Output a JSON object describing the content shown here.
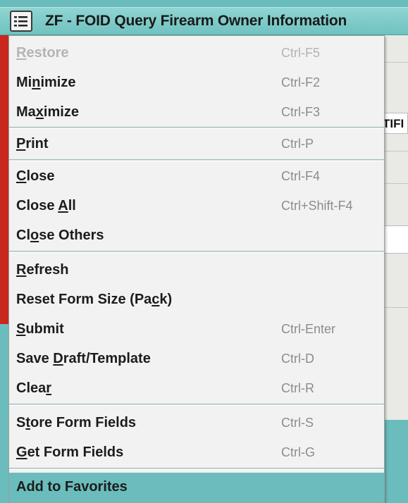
{
  "window": {
    "title": "ZF - FOID Query Firearm Owner Information"
  },
  "background": {
    "field_text": "TIFI"
  },
  "menu": {
    "items": [
      {
        "label_pre": "",
        "mnemonic": "R",
        "label_post": "estore",
        "shortcut": "Ctrl-F5",
        "enabled": false
      },
      {
        "label_pre": "Mi",
        "mnemonic": "n",
        "label_post": "imize",
        "shortcut": "Ctrl-F2",
        "enabled": true
      },
      {
        "label_pre": "Ma",
        "mnemonic": "x",
        "label_post": "imize",
        "shortcut": "Ctrl-F3",
        "enabled": true
      },
      {
        "label_pre": "",
        "mnemonic": "P",
        "label_post": "rint",
        "shortcut": "Ctrl-P",
        "enabled": true
      },
      {
        "label_pre": "",
        "mnemonic": "C",
        "label_post": "lose",
        "shortcut": "Ctrl-F4",
        "enabled": true
      },
      {
        "label_pre": "Close ",
        "mnemonic": "A",
        "label_post": "ll",
        "shortcut": "Ctrl+Shift-F4",
        "enabled": true
      },
      {
        "label_pre": "Cl",
        "mnemonic": "o",
        "label_post": "se Others",
        "shortcut": "",
        "enabled": true
      },
      {
        "label_pre": "",
        "mnemonic": "R",
        "label_post": "efresh",
        "shortcut": "",
        "enabled": true
      },
      {
        "label_pre": "Reset Form Size (Pa",
        "mnemonic": "c",
        "label_post": "k)",
        "shortcut": "",
        "enabled": true
      },
      {
        "label_pre": "",
        "mnemonic": "S",
        "label_post": "ubmit",
        "shortcut": "Ctrl-Enter",
        "enabled": true
      },
      {
        "label_pre": "Save ",
        "mnemonic": "D",
        "label_post": "raft/Template",
        "shortcut": "Ctrl-D",
        "enabled": true
      },
      {
        "label_pre": "Clea",
        "mnemonic": "r",
        "label_post": "",
        "shortcut": "Ctrl-R",
        "enabled": true
      },
      {
        "label_pre": "S",
        "mnemonic": "t",
        "label_post": "ore Form Fields",
        "shortcut": "Ctrl-S",
        "enabled": true
      },
      {
        "label_pre": "",
        "mnemonic": "G",
        "label_post": "et Form Fields",
        "shortcut": "Ctrl-G",
        "enabled": true
      },
      {
        "label_pre": "Add to Favorites",
        "mnemonic": "",
        "label_post": "",
        "shortcut": "",
        "enabled": true
      }
    ]
  },
  "colors": {
    "title_bar": "#7ccac8",
    "highlight": "#6bbcbc",
    "menu_bg": "#f2f2f2",
    "shortcut_text": "#8c8c8c",
    "disabled_text": "#b4b4b4"
  }
}
